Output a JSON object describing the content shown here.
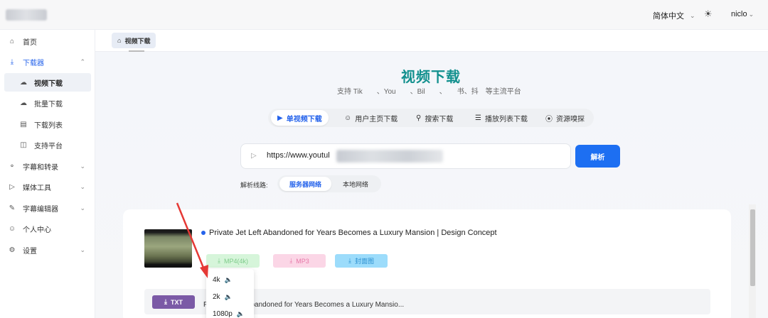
{
  "header": {
    "language": "简体中文",
    "username": "niclo"
  },
  "sidebar": {
    "items": [
      {
        "label": "首页",
        "icon": "home-icon"
      },
      {
        "label": "下载器",
        "icon": "download-icon"
      },
      {
        "label": "视频下载",
        "icon": "cloud-icon"
      },
      {
        "label": "批量下载",
        "icon": "cloud-icon"
      },
      {
        "label": "下载列表",
        "icon": "archive-icon"
      },
      {
        "label": "支持平台",
        "icon": "cube-icon"
      },
      {
        "label": "字幕和转录",
        "icon": "mic-icon"
      },
      {
        "label": "媒体工具",
        "icon": "video-icon"
      },
      {
        "label": "字幕编辑器",
        "icon": "edit-icon"
      },
      {
        "label": "个人中心",
        "icon": "user-icon"
      },
      {
        "label": "设置",
        "icon": "gear-icon"
      }
    ]
  },
  "tabs": [
    {
      "label": "视频下载"
    }
  ],
  "main": {
    "title": "视频下载",
    "subtitle": "支持 Tik　　、You　　、Bil　　、　　书、抖　等主流平台",
    "modes": [
      {
        "label": "单视频下载"
      },
      {
        "label": "用户主页下载"
      },
      {
        "label": "搜索下载"
      },
      {
        "label": "播放列表下载"
      },
      {
        "label": "资源嗅探"
      }
    ],
    "url_value": "https://www.youtul",
    "parse_button": "解析",
    "route_label": "解析线路:",
    "routes": [
      {
        "label": "服务器网络"
      },
      {
        "label": "本地网络"
      }
    ]
  },
  "result": {
    "video_title": "Private Jet Left Abandoned for Years Becomes a Luxury Mansion | Design Concept",
    "formats": [
      {
        "label": "MP4(4k)"
      },
      {
        "label": "MP3"
      },
      {
        "label": "封面图"
      }
    ],
    "quality_options": [
      "4k",
      "2k",
      "1080p"
    ],
    "txt_button": "TXT",
    "txt_title": "P　　　　　　bandoned for Years Becomes a Luxury Mansio..."
  },
  "colors": {
    "accent": "#2563eb",
    "title": "#12908e",
    "parse_button": "#1d6ff2",
    "mp4": "#d6f5da",
    "mp3": "#fbd6e6",
    "cover": "#9cdcfb",
    "txt": "#7b5aa6",
    "annotation": "#e53935"
  }
}
